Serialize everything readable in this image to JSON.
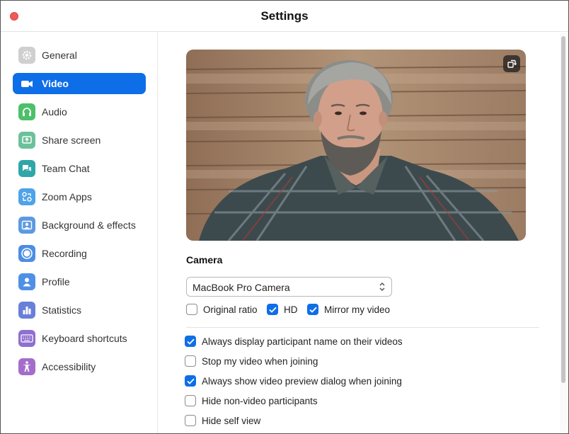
{
  "window": {
    "title": "Settings"
  },
  "sidebar": {
    "items": [
      {
        "label": "General",
        "icon": "gear-icon",
        "color": "#c9c9c9",
        "active": false
      },
      {
        "label": "Video",
        "icon": "video-camera-icon",
        "color": "#0e6ee8",
        "active": true
      },
      {
        "label": "Audio",
        "icon": "headphones-icon",
        "color": "#4cc06a",
        "active": false
      },
      {
        "label": "Share screen",
        "icon": "share-screen-icon",
        "color": "#6cc19a",
        "active": false
      },
      {
        "label": "Team Chat",
        "icon": "chat-bubbles-icon",
        "color": "#2fa6a8",
        "active": false
      },
      {
        "label": "Zoom Apps",
        "icon": "apps-icon",
        "color": "#4fa3e8",
        "active": false
      },
      {
        "label": "Background & effects",
        "icon": "background-person-icon",
        "color": "#5c9ae0",
        "active": false
      },
      {
        "label": "Recording",
        "icon": "record-icon",
        "color": "#4d8de6",
        "active": false
      },
      {
        "label": "Profile",
        "icon": "profile-person-icon",
        "color": "#4f90e6",
        "active": false
      },
      {
        "label": "Statistics",
        "icon": "bar-chart-icon",
        "color": "#6a7fd8",
        "active": false
      },
      {
        "label": "Keyboard shortcuts",
        "icon": "keyboard-icon",
        "color": "#8f6fd0",
        "active": false
      },
      {
        "label": "Accessibility",
        "icon": "accessibility-icon",
        "color": "#a46dcc",
        "active": false
      }
    ]
  },
  "camera": {
    "section_title": "Camera",
    "selected_device": "MacBook Pro Camera",
    "options": [
      {
        "label": "Original ratio",
        "checked": false
      },
      {
        "label": "HD",
        "checked": true
      },
      {
        "label": "Mirror my video",
        "checked": true
      }
    ]
  },
  "video_settings": [
    {
      "label": "Always display participant name on their videos",
      "checked": true
    },
    {
      "label": "Stop my video when joining",
      "checked": false
    },
    {
      "label": "Always show video preview dialog when joining",
      "checked": true
    },
    {
      "label": "Hide non-video participants",
      "checked": false
    },
    {
      "label": "Hide self view",
      "checked": false
    }
  ],
  "colors": {
    "accent": "#0e6ee8",
    "close_button": "#ee5b56"
  }
}
